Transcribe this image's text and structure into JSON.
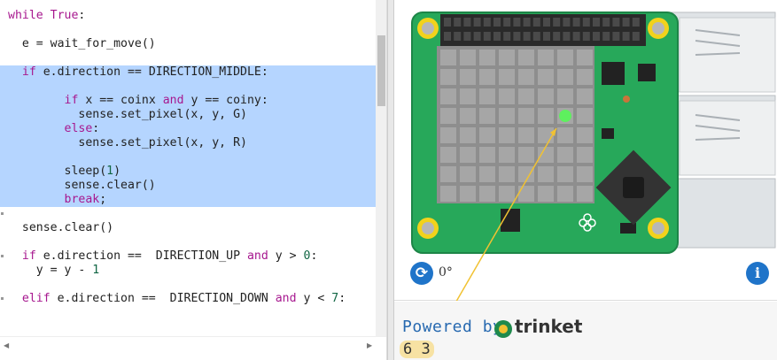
{
  "editor": {
    "lines": [
      {
        "tokens": [
          {
            "t": "while",
            "c": "kw"
          },
          {
            "t": " "
          },
          {
            "t": "True",
            "c": "kw"
          },
          {
            "t": ":"
          }
        ]
      },
      {
        "tokens": [
          {
            "t": ""
          }
        ]
      },
      {
        "tokens": [
          {
            "t": "  e = wait_for_move()"
          }
        ]
      },
      {
        "tokens": [
          {
            "t": ""
          }
        ]
      },
      {
        "tokens": [
          {
            "t": "  "
          },
          {
            "t": "if",
            "c": "kw"
          },
          {
            "t": " e.direction == DIRECTION_MIDDLE:"
          }
        ],
        "sel": true
      },
      {
        "tokens": [
          {
            "t": ""
          }
        ],
        "sel": true
      },
      {
        "tokens": [
          {
            "t": "        "
          },
          {
            "t": "if",
            "c": "kw"
          },
          {
            "t": " x == coinx "
          },
          {
            "t": "and",
            "c": "kw"
          },
          {
            "t": " y == coiny:"
          }
        ],
        "sel": true
      },
      {
        "tokens": [
          {
            "t": "          sense.set_pixel(x, y, G)"
          }
        ],
        "sel": true
      },
      {
        "tokens": [
          {
            "t": "        "
          },
          {
            "t": "else",
            "c": "kw"
          },
          {
            "t": ":"
          }
        ],
        "sel": true
      },
      {
        "tokens": [
          {
            "t": "          sense.set_pixel(x, y, R)"
          }
        ],
        "sel": true
      },
      {
        "tokens": [
          {
            "t": ""
          }
        ],
        "sel": true
      },
      {
        "tokens": [
          {
            "t": "        sleep("
          },
          {
            "t": "1",
            "c": "num"
          },
          {
            "t": ")"
          }
        ],
        "sel": true
      },
      {
        "tokens": [
          {
            "t": "        sense.clear()"
          }
        ],
        "sel": true
      },
      {
        "tokens": [
          {
            "t": "        "
          },
          {
            "t": "break",
            "c": "kw"
          },
          {
            "t": ";"
          }
        ],
        "sel": true
      },
      {
        "tokens": [
          {
            "t": ""
          }
        ]
      },
      {
        "tokens": [
          {
            "t": "  sense.clear()"
          }
        ]
      },
      {
        "tokens": [
          {
            "t": ""
          }
        ]
      },
      {
        "tokens": [
          {
            "t": "  "
          },
          {
            "t": "if",
            "c": "kw"
          },
          {
            "t": " e.direction ==  DIRECTION_UP "
          },
          {
            "t": "and",
            "c": "kw"
          },
          {
            "t": " y > "
          },
          {
            "t": "0",
            "c": "num"
          },
          {
            "t": ":"
          }
        ]
      },
      {
        "tokens": [
          {
            "t": "    y = y - "
          },
          {
            "t": "1",
            "c": "num"
          }
        ]
      },
      {
        "tokens": [
          {
            "t": ""
          }
        ]
      },
      {
        "tokens": [
          {
            "t": "  "
          },
          {
            "t": "elif",
            "c": "kw"
          },
          {
            "t": " e.direction ==  DIRECTION_DOWN "
          },
          {
            "t": "and",
            "c": "kw"
          },
          {
            "t": " y < "
          },
          {
            "t": "7",
            "c": "num"
          },
          {
            "t": ":"
          }
        ]
      }
    ]
  },
  "sim": {
    "rotation_label": "0°",
    "lit_pixel": {
      "col": 6,
      "row": 3,
      "color": "#5ef05e"
    },
    "colors": {
      "board": "#27a85a",
      "led_off": "#a6a6a6",
      "info": "#1f74c9"
    }
  },
  "output": {
    "powered_by": "Powered by",
    "brand": "trinket",
    "console_text": "6 3"
  },
  "icons": [
    "rotate-icon",
    "info-icon",
    "trinket-logo-icon"
  ]
}
